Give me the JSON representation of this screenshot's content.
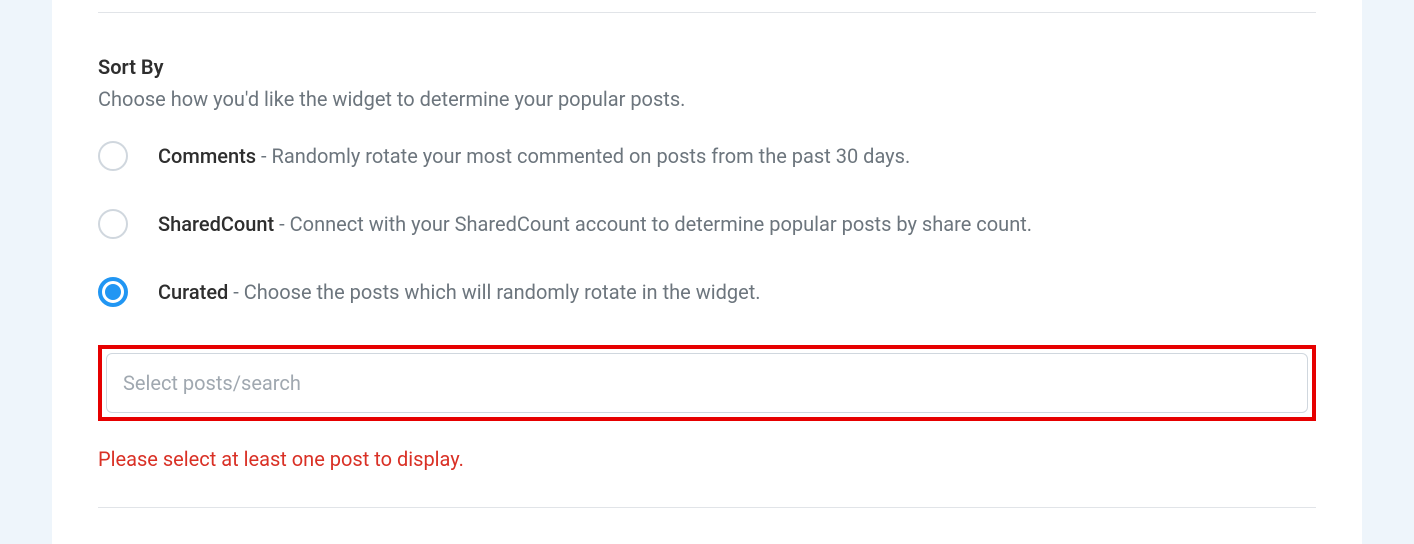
{
  "sortBy": {
    "title": "Sort By",
    "description": "Choose how you'd like the widget to determine your popular posts.",
    "options": [
      {
        "value": "comments",
        "label": "Comments",
        "desc": " - Randomly rotate your most commented on posts from the past 30 days.",
        "checked": false
      },
      {
        "value": "sharedcount",
        "label": "SharedCount",
        "desc": " - Connect with your SharedCount account to determine popular posts by share count.",
        "checked": false
      },
      {
        "value": "curated",
        "label": "Curated",
        "desc": " - Choose the posts which will randomly rotate in the widget.",
        "checked": true
      }
    ],
    "searchPlaceholder": "Select posts/search",
    "errorMessage": "Please select at least one post to display."
  }
}
